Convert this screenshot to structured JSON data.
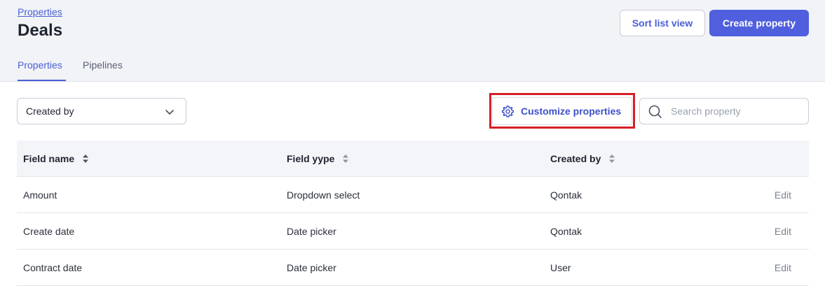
{
  "header": {
    "breadcrumb": "Properties",
    "title": "Deals",
    "sort_button": "Sort list view",
    "create_button": "Create property"
  },
  "tabs": [
    {
      "label": "Properties",
      "active": true
    },
    {
      "label": "Pipelines",
      "active": false
    }
  ],
  "toolbar": {
    "filter_value": "Created by",
    "customize_label": "Customize properties",
    "search_placeholder": "Search property"
  },
  "table": {
    "columns": [
      "Field name",
      "Field yype",
      "Created by"
    ],
    "rows": [
      {
        "field_name": "Amount",
        "field_type": "Dropdown select",
        "created_by": "Qontak",
        "action": "Edit"
      },
      {
        "field_name": "Create date",
        "field_type": "Date picker",
        "created_by": "Qontak",
        "action": "Edit"
      },
      {
        "field_name": "Contract date",
        "field_type": "Date picker",
        "created_by": "User",
        "action": "Edit"
      }
    ]
  },
  "colors": {
    "accent": "#4f5fdd",
    "highlight": "#d61f26",
    "background": "#f1f3f7"
  }
}
